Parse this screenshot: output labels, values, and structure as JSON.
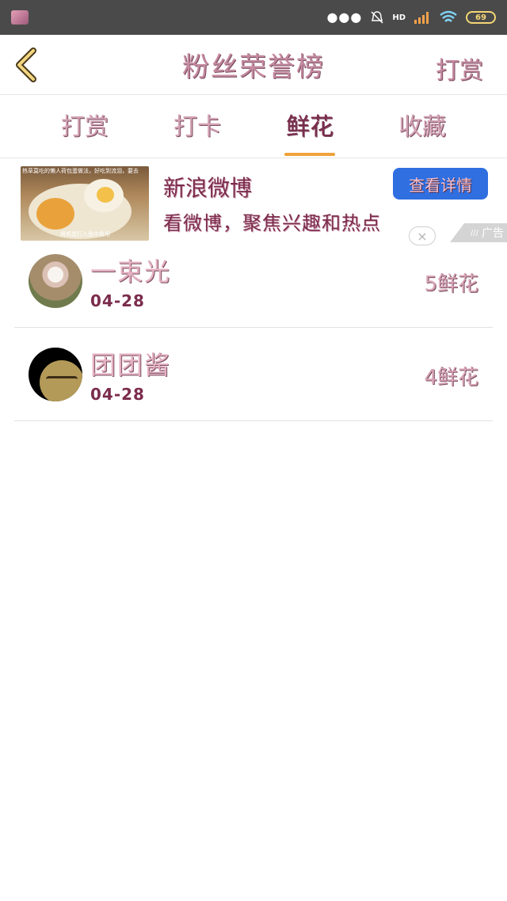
{
  "status_bar": {
    "dots": "●●●",
    "hd": "HD",
    "battery": "69"
  },
  "header": {
    "title": "粉丝荣誉榜",
    "action": "打赏"
  },
  "tabs": [
    {
      "label": "打赏"
    },
    {
      "label": "打卡"
    },
    {
      "label": "鲜花",
      "active": true
    },
    {
      "label": "收藏"
    }
  ],
  "ad": {
    "thumb_caption_top": "热草莫吃的懒人荷包蛋做法，好吃到流泪，要去",
    "thumb_caption_bottom": "将鸡蛋打入盘中备用",
    "title": "新浪微博",
    "description": "看微博，聚焦兴趣和热点",
    "cta": "查看详情",
    "close": "×",
    "badge": "广告"
  },
  "rows": [
    {
      "name": "一束光",
      "date": "04-28",
      "count": "5鲜花"
    },
    {
      "name": "团团酱",
      "date": "04-28",
      "count": "4鲜花"
    }
  ],
  "colors": {
    "status_bar_bg": "#4a4a4a",
    "tab_indicator": "#f0a23a",
    "cta_bg": "#2f6fe0",
    "text_pink": "#c48aa0",
    "text_dark": "#7b2c4c"
  }
}
